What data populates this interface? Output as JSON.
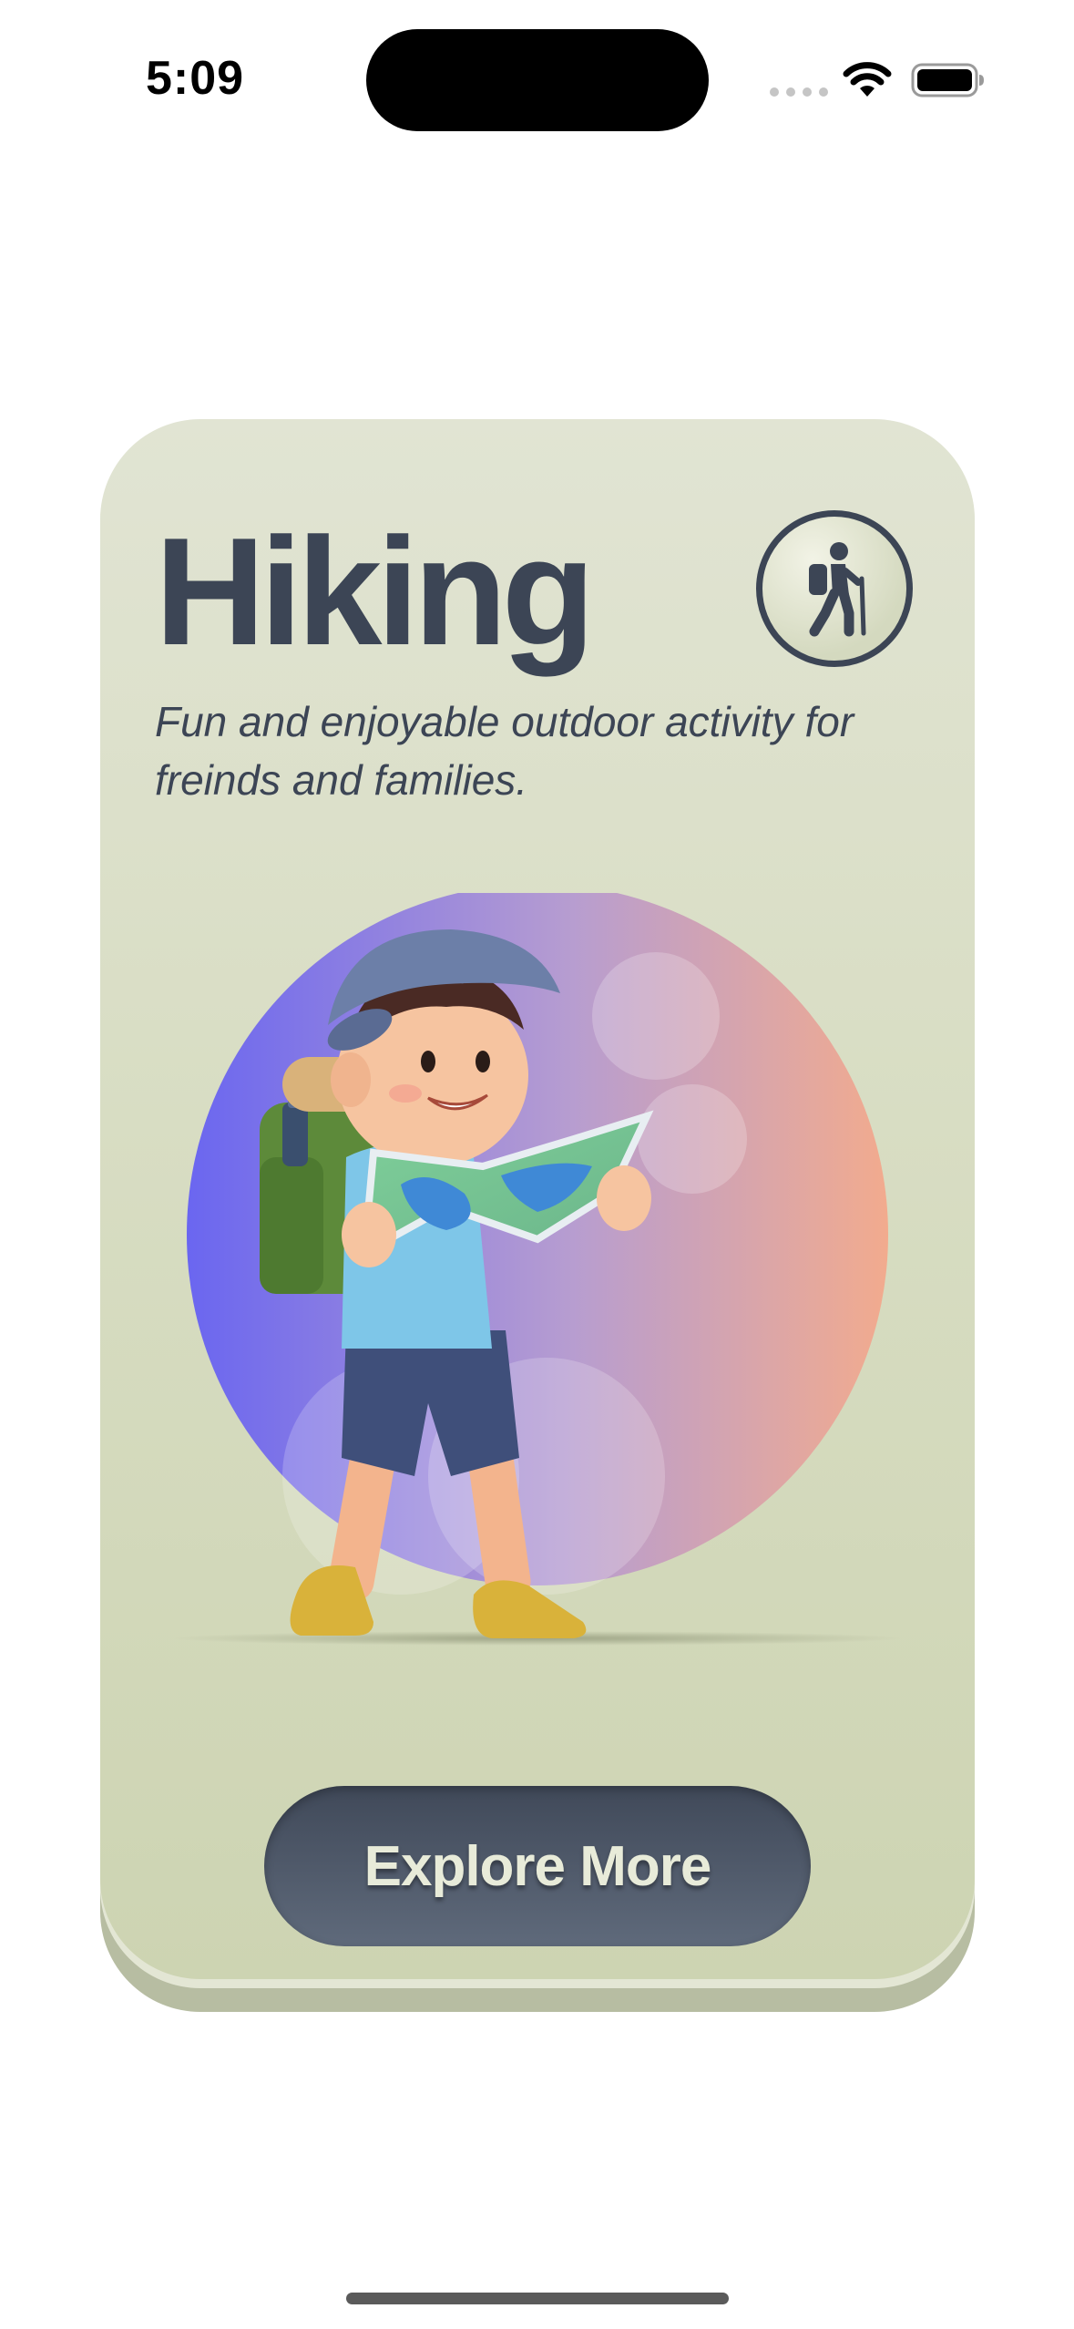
{
  "status_bar": {
    "time": "5:09"
  },
  "card": {
    "title": "Hiking",
    "subtitle": "Fun and enjoyable outdoor activity for freinds and families.",
    "badge_icon": "hiker-icon",
    "illustration": "hiker-with-map-illustration",
    "button_label": "Explore More"
  },
  "colors": {
    "card_background": "#d8ddc3",
    "title_text": "#3c4555",
    "button_background": "#4b5566",
    "button_text": "#e8ebd9",
    "circle_gradient_start": "#6a66f0",
    "circle_gradient_end": "#f2ab8e"
  }
}
